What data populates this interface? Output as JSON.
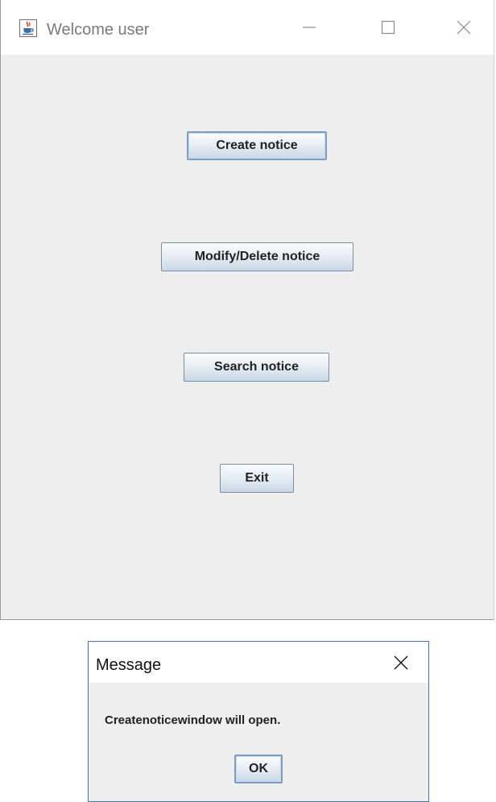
{
  "main_window": {
    "title": "Welcome user",
    "app_icon": "java-cup-icon",
    "controls": {
      "minimize": "minimize-icon",
      "maximize": "maximize-icon",
      "close": "close-icon"
    },
    "buttons": {
      "create": "Create notice",
      "modify": "Modify/Delete notice",
      "search": "Search notice",
      "exit": "Exit"
    }
  },
  "dialog": {
    "title": "Message",
    "message": "Createnoticewindow will open.",
    "ok_label": "OK",
    "close_icon": "close-icon"
  },
  "colors": {
    "window_bg": "#eeeeee",
    "titlebar_bg": "#ffffff",
    "dialog_border": "#3b78c4",
    "button_border": "#7a8ea6"
  }
}
